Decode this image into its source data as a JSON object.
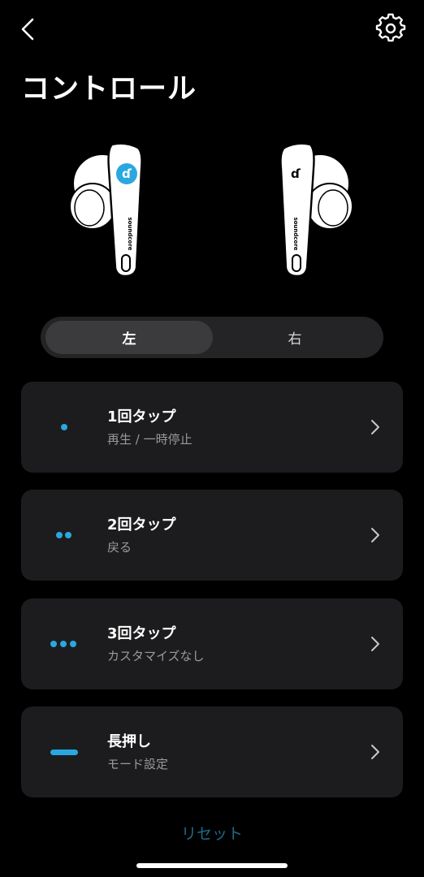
{
  "header": {
    "back_icon": "chevron-left-icon",
    "settings_icon": "gear-icon",
    "title": "コントロール"
  },
  "earbuds": {
    "brand_text": "soundcore",
    "selected_side": "left",
    "accent_color": "#29a8e0"
  },
  "side_toggle": {
    "left_label": "左",
    "right_label": "右",
    "selected": "left"
  },
  "controls": [
    {
      "title": "1回タップ",
      "action": "再生 / 一時停止",
      "icon": "one-dot-icon"
    },
    {
      "title": "2回タップ",
      "action": "戻る",
      "icon": "two-dots-icon"
    },
    {
      "title": "3回タップ",
      "action": "カスタマイズなし",
      "icon": "three-dots-icon"
    },
    {
      "title": "長押し",
      "action": "モード設定",
      "icon": "long-press-bar-icon"
    }
  ],
  "footer": {
    "reset_label": "リセット"
  },
  "colors": {
    "background": "#000000",
    "card": "#1c1c1e",
    "accent": "#29a8e0",
    "reset": "#1e6a88",
    "subtext": "#9a9a9e"
  }
}
